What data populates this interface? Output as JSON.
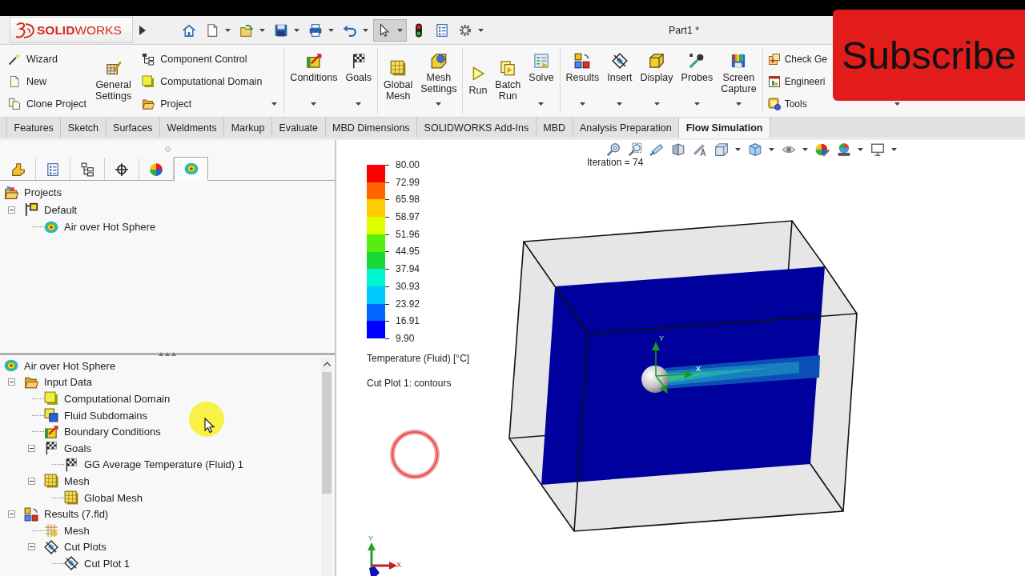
{
  "title_bar": {
    "logo": "**SOLID**WORKS",
    "document_title": "Part1 *"
  },
  "quick_access": [
    {
      "selected": false
    },
    {
      "selected": false
    },
    {
      "selected": false
    },
    {
      "selected": false
    },
    {
      "selected": false
    },
    {
      "selected": false
    },
    {
      "selected": true
    },
    {
      "selected": false
    },
    {
      "selected": false
    },
    {
      "selected": false
    }
  ],
  "ribbon": [
    {
      "columns": [
        {
          "kind": "stack",
          "items": [
            "Wizard",
            "New",
            "Clone Project"
          ],
          "menu": false
        },
        {
          "kind": "large",
          "label": "General Settings",
          "menu": false
        },
        {
          "kind": "stack",
          "items": [
            "Component Control",
            "Computational Domain",
            "Project"
          ],
          "menu": true
        }
      ]
    },
    {
      "columns": [
        {
          "kind": "large",
          "label": "Conditions",
          "menu": true
        },
        {
          "kind": "large",
          "label": "Goals",
          "menu": true
        }
      ]
    },
    {
      "columns": [
        {
          "kind": "large",
          "label": "Global Mesh",
          "menu": false
        },
        {
          "kind": "large",
          "label": "Mesh Settings",
          "menu": true
        }
      ]
    },
    {
      "columns": [
        {
          "kind": "large",
          "label": "Run",
          "menu": false
        },
        {
          "kind": "large",
          "label": "Batch Run",
          "menu": false
        },
        {
          "kind": "large",
          "label": "Solve",
          "menu": true
        }
      ]
    },
    {
      "columns": [
        {
          "kind": "large",
          "label": "Results",
          "menu": true
        },
        {
          "kind": "large",
          "label": "Insert",
          "menu": true
        },
        {
          "kind": "large",
          "label": "Display",
          "menu": true
        },
        {
          "kind": "large",
          "label": "Probes",
          "menu": true
        },
        {
          "kind": "large",
          "label": "Screen Capture",
          "menu": true
        }
      ]
    },
    {
      "columns": [
        {
          "kind": "stack",
          "items": [
            "Check Ge",
            "Engineeri",
            "Tools"
          ],
          "menu": true
        }
      ]
    }
  ],
  "command_tabs": [
    {
      "label": "Features",
      "selected": false
    },
    {
      "label": "Sketch",
      "selected": false
    },
    {
      "label": "Surfaces",
      "selected": false
    },
    {
      "label": "Weldments",
      "selected": false
    },
    {
      "label": "Markup",
      "selected": false
    },
    {
      "label": "Evaluate",
      "selected": false
    },
    {
      "label": "MBD Dimensions",
      "selected": false
    },
    {
      "label": "SOLIDWORKS Add-Ins",
      "selected": false
    },
    {
      "label": "MBD",
      "selected": false
    },
    {
      "label": "Analysis Preparation",
      "selected": false
    },
    {
      "label": "Flow Simulation",
      "selected": true
    }
  ],
  "panel_tabs": [
    {
      "selected": false
    },
    {
      "selected": false
    },
    {
      "selected": false
    },
    {
      "selected": false
    },
    {
      "selected": false
    },
    {
      "selected": true
    }
  ],
  "projects_tree": [
    {
      "label": "Projects",
      "children": [
        {
          "label": "Default",
          "expanded": true,
          "children": [
            {
              "label": "Air over Hot Sphere"
            }
          ]
        }
      ]
    }
  ],
  "analysis_tree": [
    {
      "label": "Air over Hot Sphere",
      "children": [
        {
          "label": "Input Data",
          "expanded": true,
          "children": [
            {
              "label": "Computational Domain"
            },
            {
              "label": "Fluid Subdomains"
            },
            {
              "label": "Boundary Conditions"
            },
            {
              "label": "Goals",
              "expanded": true,
              "children": [
                {
                  "label": "GG Average Temperature (Fluid) 1"
                }
              ]
            },
            {
              "label": "Mesh",
              "expanded": true,
              "children": [
                {
                  "label": "Global Mesh"
                }
              ]
            }
          ]
        },
        {
          "label": "Results (7.fld)",
          "expanded": true,
          "children": [
            {
              "label": "Mesh"
            },
            {
              "label": "Cut Plots",
              "expanded": true,
              "children": [
                {
                  "label": "Cut Plot 1"
                }
              ]
            }
          ]
        }
      ]
    }
  ],
  "graphics_area": {
    "iteration": "Iteration = 74",
    "legend": {
      "values": [
        "80.00",
        "72.99",
        "65.98",
        "58.97",
        "51.96",
        "44.95",
        "37.94",
        "30.93",
        "23.92",
        "16.91",
        "9.90"
      ],
      "bands": [
        {
          "color": "#ff0000"
        },
        {
          "color": "#ff6600"
        },
        {
          "color": "#ffcc00"
        },
        {
          "color": "#ddff00"
        },
        {
          "color": "#55ee10"
        },
        {
          "color": "#18d838"
        },
        {
          "color": "#00f5d0"
        },
        {
          "color": "#00c8ff"
        },
        {
          "color": "#0066ff"
        },
        {
          "color": "#0000ff"
        }
      ],
      "title": "Temperature (Fluid) [°C]"
    },
    "plot_label": "Cut Plot 1: contours",
    "model_triad": {
      "y_label": "Y",
      "x_label": "X"
    },
    "view_triad": {
      "y_label": "Y",
      "x_label": "X"
    }
  },
  "overlay": {
    "text": "Subscribe"
  }
}
